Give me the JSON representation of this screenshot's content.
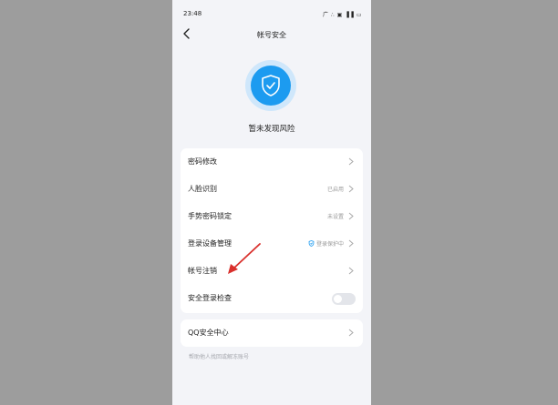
{
  "status_bar": {
    "time": "23:48",
    "icons": "广 ∴ ▣ ▐▐ ▭"
  },
  "header": {
    "title": "帐号安全"
  },
  "security": {
    "status_text": "暂未发现风险",
    "badge_color": "#1c9bf0"
  },
  "settings": {
    "items": [
      {
        "label": "密码修改",
        "status": ""
      },
      {
        "label": "人脸识别",
        "status": "已启用"
      },
      {
        "label": "手势密码锁定",
        "status": "未设置"
      },
      {
        "label": "登录设备管理",
        "status": "登录保护中"
      },
      {
        "label": "帐号注销",
        "status": ""
      },
      {
        "label": "安全登录检查",
        "toggle": false
      }
    ]
  },
  "qq_center": {
    "label": "QQ安全中心",
    "hint": "帮助他人找回或解冻账号"
  },
  "annotation": {
    "arrow_color": "#d9302c"
  }
}
